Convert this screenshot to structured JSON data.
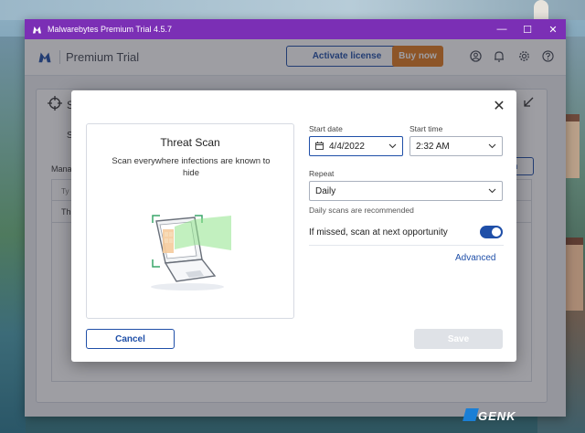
{
  "app": {
    "window_title": "Malwarebytes Premium Trial  4.5.7",
    "product_name": "Premium Trial",
    "activate_label": "Activate license",
    "buy_label": "Buy now",
    "window_controls": [
      "—",
      "☐",
      "✕"
    ]
  },
  "background_panel": {
    "title_partial": "S",
    "tab_partial": "S",
    "label_partial": "Mana",
    "table_header_partial": "Ty",
    "table_row_partial": "Th",
    "button_partial": "n"
  },
  "dialog": {
    "scan_title": "Threat Scan",
    "scan_description": "Scan everywhere infections are known to hide",
    "start_date_label": "Start date",
    "start_date_value": "4/4/2022",
    "start_time_label": "Start time",
    "start_time_value": "2:32 AM",
    "repeat_label": "Repeat",
    "repeat_value": "Daily",
    "repeat_hint": "Daily scans are recommended",
    "missed_label": "If missed, scan at next opportunity",
    "missed_enabled": true,
    "advanced_label": "Advanced",
    "cancel_label": "Cancel",
    "save_label": "Save",
    "close_glyph": "✕"
  },
  "watermark": "GENK",
  "colors": {
    "titlebar": "#7b2fb5",
    "accent": "#1f4fa8",
    "buy": "#e07a1f"
  }
}
